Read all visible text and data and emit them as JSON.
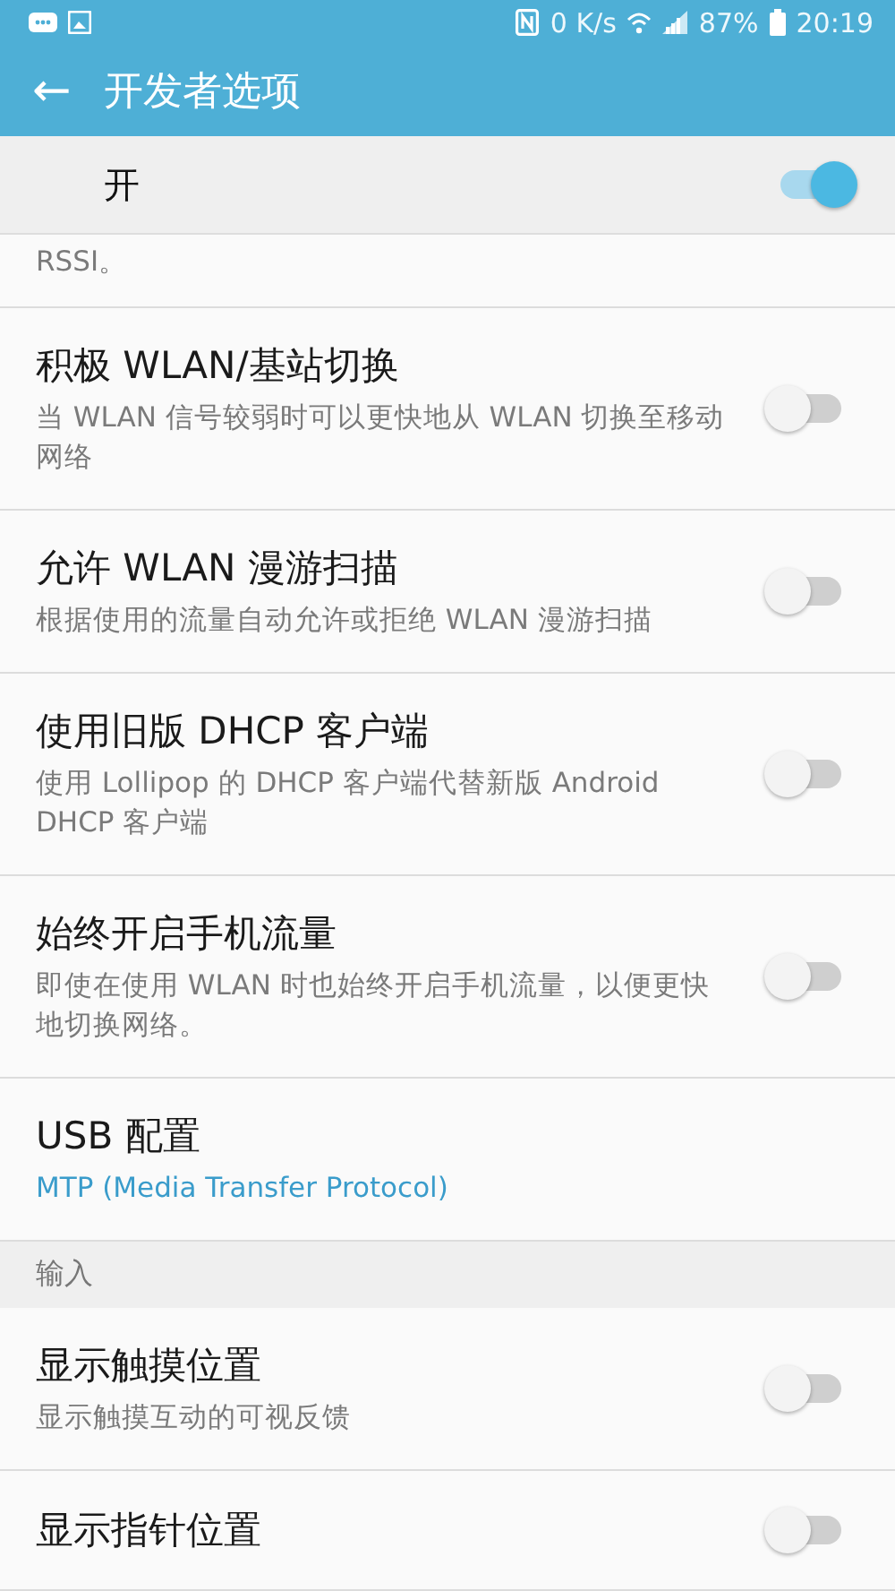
{
  "status_bar": {
    "speed": "0 K/s",
    "battery": "87%",
    "time": "20:19"
  },
  "app_bar": {
    "back": "←",
    "title": "开发者选项"
  },
  "master": {
    "label": "开",
    "on": true
  },
  "items": [
    {
      "kind": "partial",
      "summary": "RSSI。"
    },
    {
      "kind": "switch",
      "title": "积极 WLAN/基站切换",
      "summary": "当 WLAN 信号较弱时可以更快地从 WLAN 切换至移动网络",
      "on": false
    },
    {
      "kind": "switch",
      "title": "允许 WLAN 漫游扫描",
      "summary": "根据使用的流量自动允许或拒绝 WLAN 漫游扫描",
      "on": false
    },
    {
      "kind": "switch",
      "title": "使用旧版 DHCP 客户端",
      "summary": "使用 Lollipop 的 DHCP 客户端代替新版 Android DHCP 客户端",
      "on": false
    },
    {
      "kind": "switch",
      "title": "始终开启手机流量",
      "summary": "即使在使用 WLAN 时也始终开启手机流量，以便更快地切换网络。",
      "on": false
    },
    {
      "kind": "value",
      "title": "USB 配置",
      "summary": "MTP (Media Transfer Protocol)"
    },
    {
      "kind": "header",
      "title": "输入"
    },
    {
      "kind": "switch",
      "title": "显示触摸位置",
      "summary": "显示触摸互动的可视反馈",
      "on": false
    },
    {
      "kind": "switch",
      "title": "显示指针位置",
      "on": false
    }
  ]
}
